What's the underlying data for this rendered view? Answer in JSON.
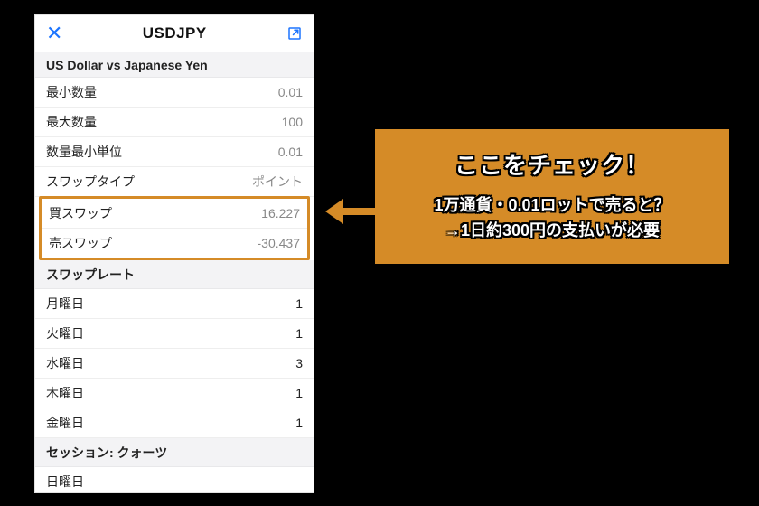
{
  "panel": {
    "title": "USDJPY",
    "pair_name": "US Dollar vs Japanese Yen",
    "specs": [
      {
        "label": "最小数量",
        "value": "0.01"
      },
      {
        "label": "最大数量",
        "value": "100"
      },
      {
        "label": "数量最小単位",
        "value": "0.01"
      },
      {
        "label": "スワップタイプ",
        "value": "ポイント"
      }
    ],
    "swap": {
      "buy": {
        "label": "買スワップ",
        "value": "16.227"
      },
      "sell": {
        "label": "売スワップ",
        "value": "-30.437"
      }
    },
    "rate_heading": "スワップレート",
    "rates": [
      {
        "label": "月曜日",
        "value": "1"
      },
      {
        "label": "火曜日",
        "value": "1"
      },
      {
        "label": "水曜日",
        "value": "3"
      },
      {
        "label": "木曜日",
        "value": "1"
      },
      {
        "label": "金曜日",
        "value": "1"
      }
    ],
    "session_heading": "セッション:   クォーツ",
    "session_first": "日曜日"
  },
  "callout": {
    "line1": "ここをチェック！",
    "line2": "1万通貨・0.01ロットで売ると？",
    "line3": "→1日約300円の支払いが必要"
  },
  "colors": {
    "accent_blue": "#1b74ff",
    "callout_orange": "#d58b27"
  }
}
